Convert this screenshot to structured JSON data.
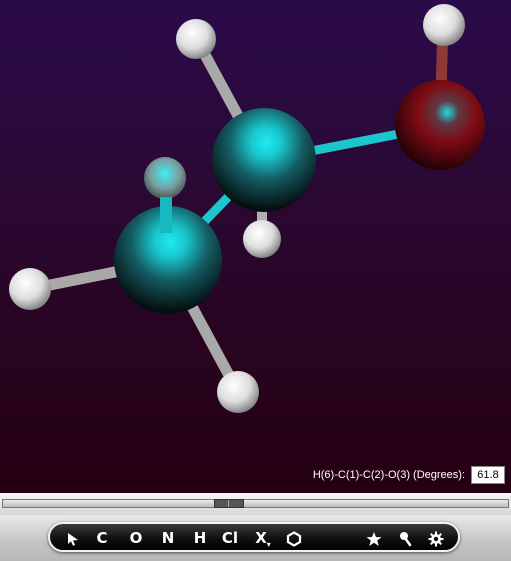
{
  "dihedral": {
    "label": "H(6)-C(1)-C(2)-O(3) (Degrees):",
    "value": "61.8"
  },
  "toolbar": {
    "tools": [
      "C",
      "O",
      "N",
      "H",
      "Cl",
      "X"
    ],
    "x_arrow": "▾"
  },
  "colors": {
    "carbon": "#1fd7e0",
    "oxygen": "#8a0b16",
    "hydrogen": "#ffffff",
    "background_top": "#2b0a4a",
    "background_bottom": "#250012"
  }
}
